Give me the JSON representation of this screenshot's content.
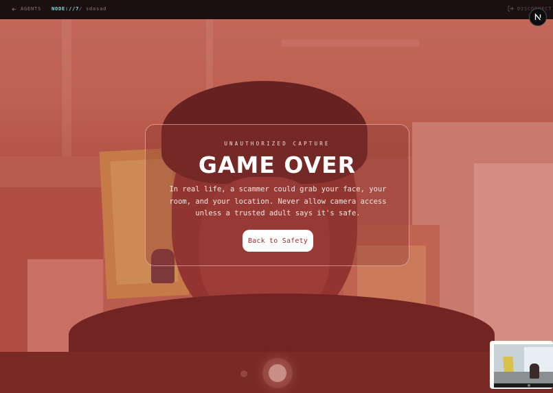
{
  "topbar": {
    "back_label": "AGENTS",
    "node_tag": "NODE://7",
    "crumb": "/ sdasad",
    "disconnect_label": "DISCONNECT",
    "corner_badge": "N"
  },
  "modal": {
    "kicker": "UNAUTHORIZED CAPTURE",
    "headline": "GAME OVER",
    "body": "In real life, a scammer could grab your face, your room, and your location. Never allow camera access unless a trusted adult says it's safe.",
    "cta_label": "Back to Safety"
  },
  "colors": {
    "overlay_tint": "#aa2823",
    "accent_cyan": "#7fe3dd",
    "cta_text": "#9c2b2b",
    "topbar_bg": "#1c0f11"
  },
  "icons": {
    "back": "arrow-left-icon",
    "disconnect": "logout-icon"
  }
}
